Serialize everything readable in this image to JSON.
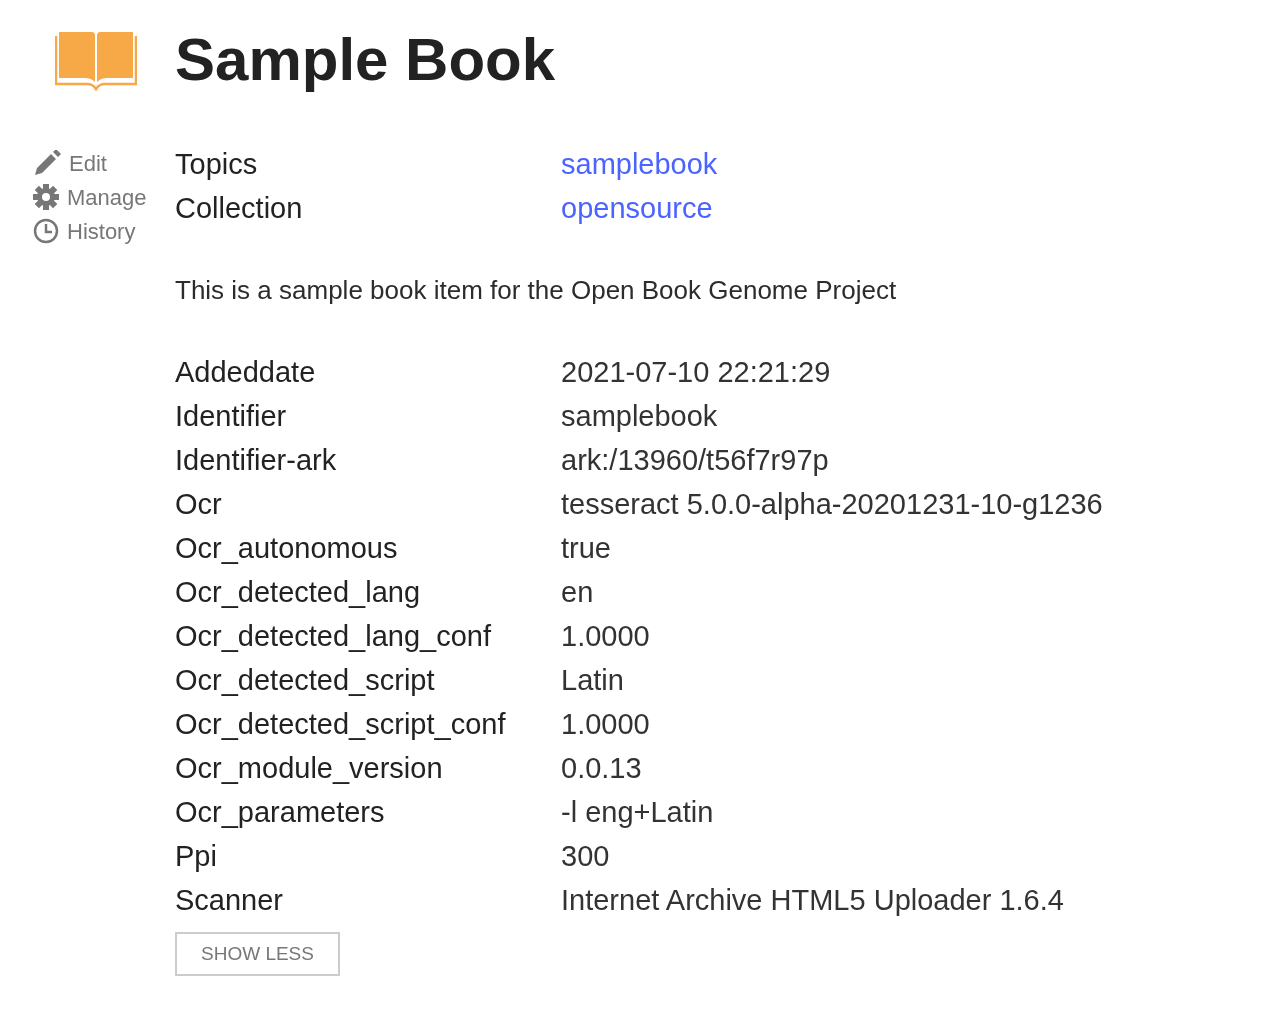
{
  "title": "Sample Book",
  "actions": [
    {
      "kind": "edit",
      "label": "Edit"
    },
    {
      "kind": "manage",
      "label": "Manage"
    },
    {
      "kind": "history",
      "label": "History"
    }
  ],
  "links": [
    {
      "label": "Topics",
      "value": "samplebook"
    },
    {
      "label": "Collection",
      "value": "opensource"
    }
  ],
  "description": "This is a sample book item for the Open Book Genome Project",
  "metadata": [
    {
      "label": "Addeddate",
      "value": "2021-07-10 22:21:29"
    },
    {
      "label": "Identifier",
      "value": "samplebook"
    },
    {
      "label": "Identifier-ark",
      "value": "ark:/13960/t56f7r97p"
    },
    {
      "label": "Ocr",
      "value": "tesseract 5.0.0-alpha-20201231-10-g1236"
    },
    {
      "label": "Ocr_autonomous",
      "value": "true"
    },
    {
      "label": "Ocr_detected_lang",
      "value": "en"
    },
    {
      "label": "Ocr_detected_lang_conf",
      "value": "1.0000"
    },
    {
      "label": "Ocr_detected_script",
      "value": "Latin"
    },
    {
      "label": "Ocr_detected_script_conf",
      "value": "1.0000"
    },
    {
      "label": "Ocr_module_version",
      "value": "0.0.13"
    },
    {
      "label": "Ocr_parameters",
      "value": "-l eng+Latin"
    },
    {
      "label": "Ppi",
      "value": "300"
    },
    {
      "label": "Scanner",
      "value": "Internet Archive HTML5 Uploader 1.6.4"
    }
  ],
  "toggle_button": "SHOW LESS"
}
